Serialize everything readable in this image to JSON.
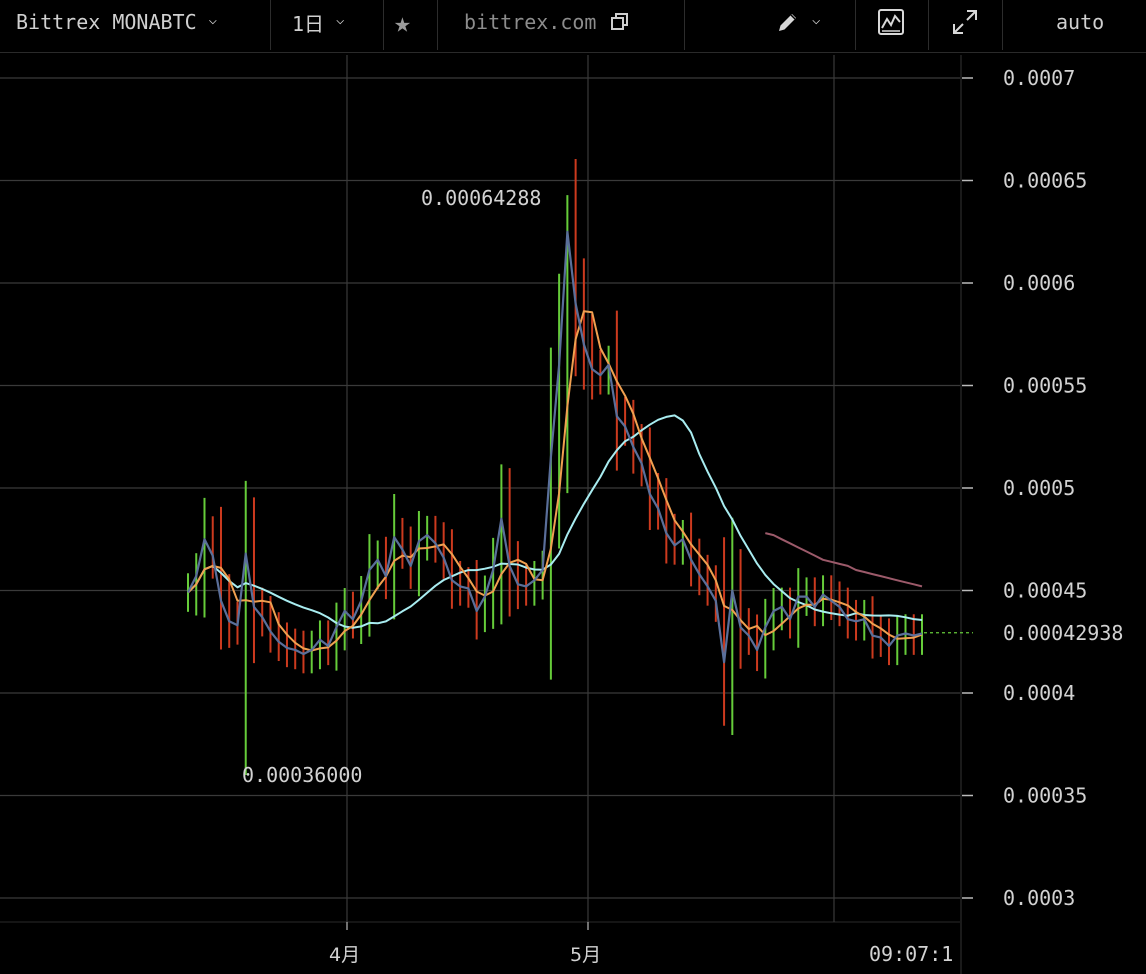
{
  "toolbar": {
    "symbol": "Bittrex MONABTC",
    "interval": "1日",
    "source": "bittrex.com",
    "scale_mode": "auto",
    "icons": [
      "chevron-down-icon",
      "star-icon",
      "copy-icon",
      "pencil-icon",
      "indicator-icon",
      "fullscreen-icon"
    ]
  },
  "chart_data": {
    "type": "candlestick",
    "pair": "MONABTC",
    "exchange": "Bittrex",
    "y_axis": {
      "ticks": [
        "0.0007",
        "0.00065",
        "0.0006",
        "0.00055",
        "0.0005",
        "0.00045",
        "0.0004",
        "0.00035",
        "0.0003"
      ],
      "range": [
        0.00029,
        0.000715
      ]
    },
    "x_axis": {
      "ticks": [
        "4月",
        "5月"
      ],
      "time_label": "09:07:1"
    },
    "current_price": "0.00042938",
    "annotations": {
      "high_label": "0.00064288",
      "low_label": "0.00036000"
    },
    "colors": {
      "up": "#66cc3a",
      "down": "#cc3a1e",
      "ma_fast": "#5a6f9a",
      "ma_mid": "#f0a050",
      "ma_slow": "#a8ecf0",
      "ma_long": "#9c5a6a",
      "grid": "#3a3a3a"
    },
    "close": [
      0.000449,
      0.000457,
      0.000475,
      0.000467,
      0.000445,
      0.000435,
      0.000433,
      0.000468,
      0.000442,
      0.000437,
      0.00043,
      0.000425,
      0.000422,
      0.000421,
      0.000419,
      0.000421,
      0.000426,
      0.000423,
      0.000432,
      0.00044,
      0.000436,
      0.000445,
      0.00046,
      0.000465,
      0.000457,
      0.000476,
      0.00047,
      0.000462,
      0.000474,
      0.000477,
      0.000473,
      0.000466,
      0.000455,
      0.000452,
      0.000451,
      0.00044,
      0.000447,
      0.00046,
      0.000485,
      0.000462,
      0.000453,
      0.000452,
      0.000455,
      0.00046,
      0.000515,
      0.00056,
      0.000625,
      0.00059,
      0.00057,
      0.000558,
      0.000555,
      0.00056,
      0.000535,
      0.00053,
      0.00052,
      0.000512,
      0.000497,
      0.00049,
      0.000478,
      0.000472,
      0.000475,
      0.000465,
      0.000458,
      0.000452,
      0.000445,
      0.000415,
      0.00045,
      0.000432,
      0.000428,
      0.000421,
      0.000432,
      0.00044,
      0.000442,
      0.000436,
      0.000447,
      0.000447,
      0.000442,
      0.000448,
      0.000445,
      0.000442,
      0.000436,
      0.000435,
      0.000436,
      0.000428,
      0.000427,
      0.000423,
      0.000428,
      0.000429,
      0.000428,
      0.000429
    ],
    "ma_long": [
      0.000478,
      0.000477,
      0.000475,
      0.000473,
      0.000471,
      0.000469,
      0.000467,
      0.000465,
      0.000464,
      0.000463,
      0.000462,
      0.00046,
      0.000459,
      0.000458,
      0.000457,
      0.000456,
      0.000455,
      0.000454,
      0.000453,
      0.000452
    ]
  }
}
